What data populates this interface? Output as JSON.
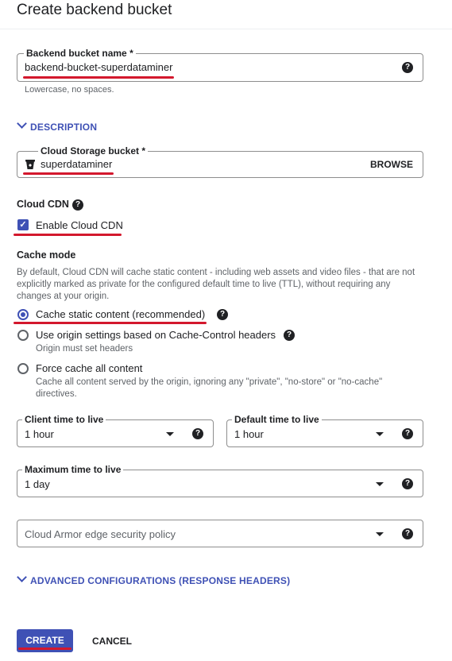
{
  "page": {
    "title": "Create backend bucket"
  },
  "backend_bucket_name": {
    "label": "Backend bucket name",
    "required_marker": "*",
    "value": "backend-bucket-superdataminer",
    "hint": "Lowercase, no spaces."
  },
  "description_toggle": {
    "label": "DESCRIPTION"
  },
  "cloud_storage_bucket": {
    "label": "Cloud Storage bucket",
    "required_marker": "*",
    "value": "superdataminer",
    "browse_label": "BROWSE"
  },
  "cloud_cdn": {
    "heading": "Cloud CDN",
    "enable_label": "Enable Cloud CDN",
    "enabled": true
  },
  "cache_mode": {
    "heading": "Cache mode",
    "description": "By default, Cloud CDN will cache static content - including web assets and video files - that are not explicitly marked as private for the configured default time to live (TTL), without requiring any changes at your origin.",
    "options": [
      {
        "label": "Cache static content (recommended)",
        "selected": true
      },
      {
        "label": "Use origin settings based on Cache-Control headers",
        "sub": "Origin must set headers",
        "selected": false
      },
      {
        "label": "Force cache all content",
        "sub": "Cache all content served by the origin, ignoring any \"private\", \"no-store\" or \"no-cache\" directives.",
        "selected": false
      }
    ]
  },
  "client_ttl": {
    "label": "Client time to live",
    "value": "1 hour"
  },
  "default_ttl": {
    "label": "Default time to live",
    "value": "1 hour"
  },
  "max_ttl": {
    "label": "Maximum time to live",
    "value": "1 day"
  },
  "armor_policy": {
    "placeholder": "Cloud Armor edge security policy"
  },
  "advanced_toggle": {
    "label": "ADVANCED CONFIGURATIONS (RESPONSE HEADERS)"
  },
  "actions": {
    "create_label": "CREATE",
    "cancel_label": "CANCEL"
  },
  "icons": {
    "help": "help-circle-icon",
    "bucket": "storage-bucket-icon",
    "check": "checkmark-icon",
    "dropdown": "dropdown-arrow-icon",
    "chevron": "chevron-down-icon"
  },
  "colors": {
    "accent": "#3f51b5",
    "annotation": "#d3182d"
  }
}
